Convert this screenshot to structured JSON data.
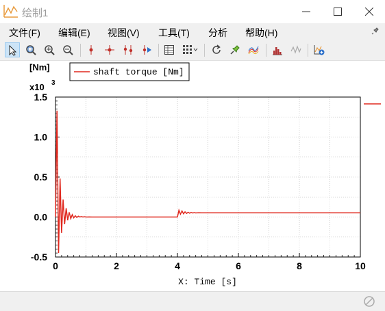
{
  "window": {
    "title": "绘制1",
    "app_icon": "plot-window-icon",
    "controls": [
      "minimize-icon",
      "maximize-icon",
      "close-icon"
    ]
  },
  "menu": {
    "items": [
      {
        "label": "文件(F)"
      },
      {
        "label": "编辑(E)"
      },
      {
        "label": "视图(V)"
      },
      {
        "label": "工具(T)"
      },
      {
        "label": "分析"
      },
      {
        "label": "帮助(H)"
      }
    ],
    "pin_icon": "pin-icon"
  },
  "toolbar": {
    "items": [
      {
        "icon": "select-arrow-icon",
        "active": true
      },
      {
        "icon": "zoom-region-icon"
      },
      {
        "icon": "zoom-in-icon"
      },
      {
        "icon": "zoom-out-icon"
      },
      {
        "icon": "cursor-single-icon"
      },
      {
        "icon": "cursor-cross-icon"
      },
      {
        "icon": "cursor-double-icon"
      },
      {
        "icon": "cursor-play-icon"
      },
      {
        "icon": "table-icon"
      },
      {
        "icon": "grid-layout-dropdown-icon"
      },
      {
        "icon": "refresh-icon"
      },
      {
        "icon": "pin-marker-icon"
      },
      {
        "icon": "curves-icon"
      },
      {
        "icon": "histogram-icon"
      },
      {
        "icon": "fft-icon"
      },
      {
        "icon": "add-plot-icon"
      }
    ]
  },
  "status": {
    "icon": "sync-disabled-icon"
  },
  "colors": {
    "series": "#e0281e",
    "grid": "#c8c8c8",
    "frame": "#000000"
  },
  "chart_data": {
    "type": "line",
    "y_unit": "[Nm]",
    "y_scale_label": "x10",
    "y_scale_exp": "3",
    "xlabel": "X: Time [s]",
    "xlim": [
      0,
      10
    ],
    "ylim": [
      -0.5,
      1.5
    ],
    "x_ticks": [
      "0",
      "2",
      "4",
      "6",
      "8",
      "10"
    ],
    "y_ticks": [
      "1.5",
      "1.0",
      "0.5",
      "0.0",
      "-0.5"
    ],
    "grid": true,
    "legend_position": "top-left",
    "series": [
      {
        "name": "shaft torque [Nm]",
        "x": [
          0,
          0.05,
          0.1,
          0.15,
          0.2,
          0.25,
          0.3,
          0.35,
          0.4,
          0.45,
          0.5,
          0.55,
          0.6,
          0.65,
          0.7,
          0.75,
          0.8,
          0.85,
          0.9,
          0.95,
          1.0,
          1.1,
          1.2,
          1.5,
          2.0,
          3.0,
          3.98,
          4.0,
          4.05,
          4.1,
          4.15,
          4.2,
          4.25,
          4.3,
          4.35,
          4.4,
          4.45,
          4.5,
          4.55,
          4.6,
          4.7,
          4.8,
          5.0,
          6.0,
          8.0,
          10.0
        ],
        "y": [
          0.0,
          1.33,
          -0.45,
          0.48,
          -0.2,
          0.22,
          -0.09,
          0.11,
          -0.04,
          0.06,
          -0.02,
          0.03,
          -0.01,
          0.015,
          -0.005,
          0.01,
          0.0,
          0.005,
          0.0,
          0.003,
          0.0,
          0.001,
          0.0,
          0.0,
          0.0,
          0.0,
          0.0,
          0.0,
          0.085,
          0.035,
          0.075,
          0.04,
          0.065,
          0.045,
          0.06,
          0.048,
          0.057,
          0.05,
          0.055,
          0.051,
          0.053,
          0.052,
          0.052,
          0.052,
          0.052,
          0.052
        ]
      }
    ]
  }
}
